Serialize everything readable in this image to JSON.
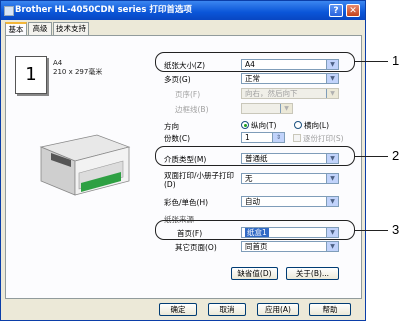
{
  "window": {
    "title": "Brother HL-4050CDN series 打印首选项",
    "help_glyph": "?",
    "close_glyph": "✕"
  },
  "tabs": [
    {
      "label": "基本"
    },
    {
      "label": "高级"
    },
    {
      "label": "技术支持"
    }
  ],
  "paper_preview": {
    "pages_glyph": "1",
    "size_name": "A4",
    "size_dims": "210 x 297毫米"
  },
  "fields": {
    "paper_size": {
      "label": "纸张大小(Z)",
      "value": "A4"
    },
    "multiple_pages": {
      "label": "多页(G)",
      "value": "正常"
    },
    "page_order": {
      "label": "页序(F)",
      "value": "向右，然后向下"
    },
    "border_line": {
      "label": "边框线(B)",
      "value": ""
    },
    "orientation": {
      "label": "方向",
      "portrait": "纵向(T)",
      "landscape": "横向(L)",
      "selected": "portrait"
    },
    "copies": {
      "label": "份数(C)",
      "value": "1",
      "collate_label": "逐份打印(S)"
    },
    "media_type": {
      "label": "介质类型(M)",
      "value": "普通纸"
    },
    "duplex": {
      "label": "双面打印/小册子打印(D)",
      "value": "无"
    },
    "color_mode": {
      "label": "彩色/单色(H)",
      "value": "自动"
    },
    "paper_source_group": {
      "label": "纸张来源"
    },
    "first_page": {
      "label": "首页(F)",
      "value": "纸盒1"
    },
    "other_pages": {
      "label": "其它页面(O)",
      "value": "同首页"
    }
  },
  "buttons": {
    "default": "缺省值(D)",
    "about": "关于(B)...",
    "ok": "确定",
    "cancel": "取消",
    "apply": "应用(A)",
    "help": "帮助"
  },
  "callouts": [
    "1",
    "2",
    "3"
  ]
}
